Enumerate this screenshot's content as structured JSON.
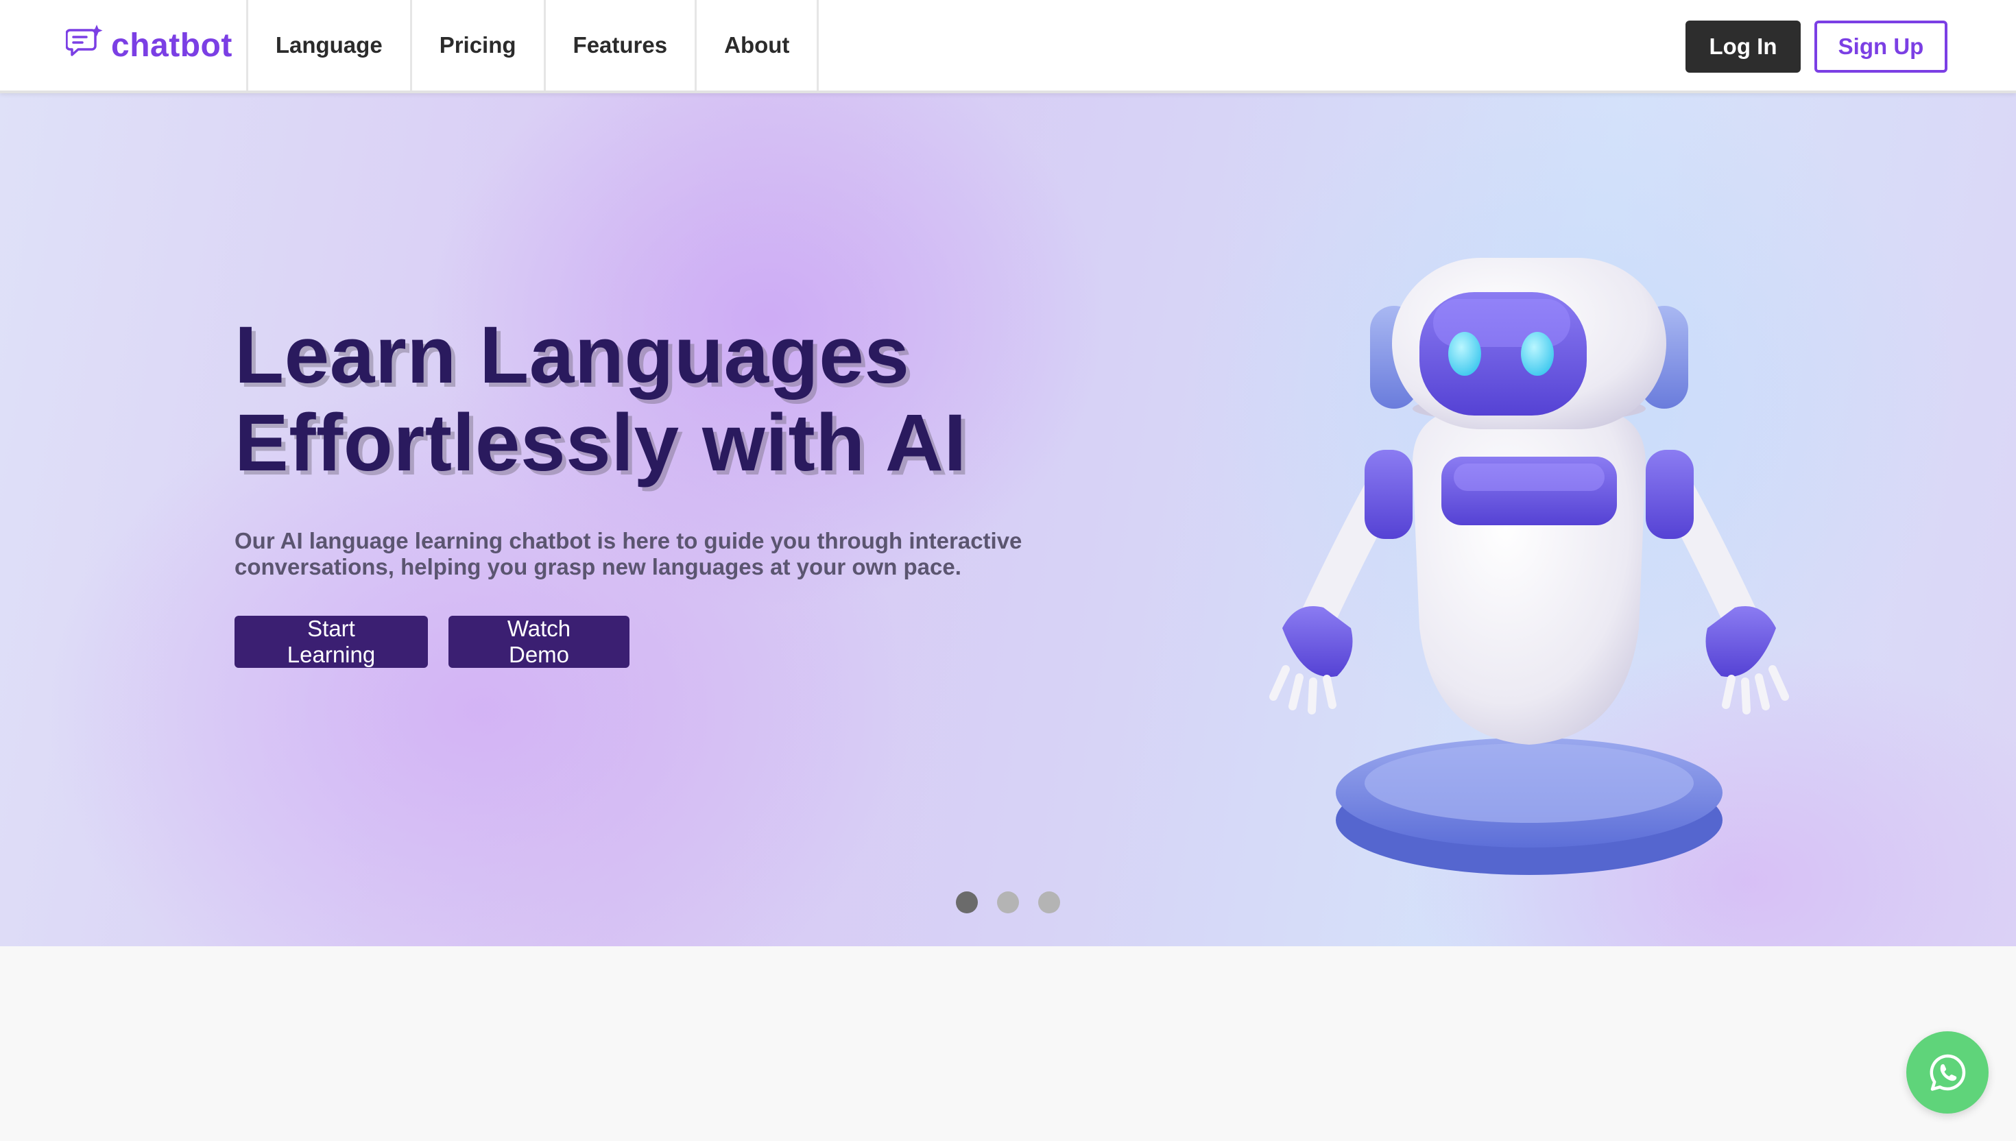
{
  "brand": {
    "name": "chatbot",
    "icon": "chat-sparkle-icon",
    "color": "#7b3fe4"
  },
  "nav": {
    "links": [
      {
        "label": "Language"
      },
      {
        "label": "Pricing"
      },
      {
        "label": "Features"
      },
      {
        "label": "About"
      }
    ],
    "login_label": "Log In",
    "signup_label": "Sign Up"
  },
  "hero": {
    "title_line1": "Learn Languages",
    "title_line2": "Effortlessly with AI",
    "subtitle_line1": "Our AI language learning chatbot is here to guide you through interactive",
    "subtitle_line2": "conversations, helping you grasp new languages at your own pace.",
    "start_label": "Start Learning",
    "demo_label": "Watch Demo",
    "image": "robot-illustration",
    "carousel": {
      "slides": 3,
      "active": 1
    }
  },
  "floating": {
    "icon": "whatsapp-icon",
    "color": "#5fd47a"
  },
  "colors": {
    "accent": "#7b3fe4",
    "button_primary": "#3b1f72",
    "login_bg": "#2d2d2d",
    "title": "#2a1a5e"
  }
}
